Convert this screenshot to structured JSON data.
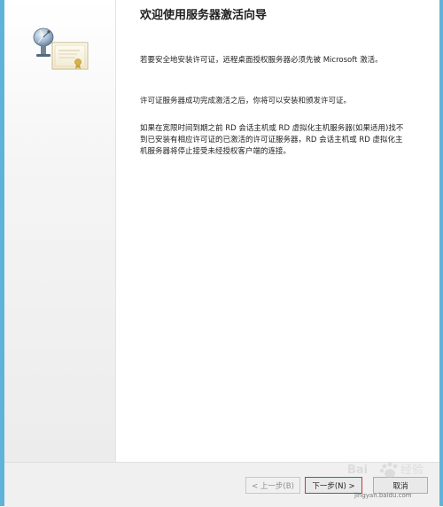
{
  "wizard": {
    "title": "欢迎使用服务器激活向导",
    "paragraph1": "若要安全地安装许可证，远程桌面授权服务器必须先被 Microsoft 激活。",
    "paragraph2": "许可证服务器成功完成激活之后，你将可以安装和颁发许可证。",
    "paragraph3": "如果在宽限时间到期之前 RD 会话主机或 RD 虚拟化主机服务器(如果适用)找不到已安装有相应许可证的已激活的许可证服务器，RD 会话主机或 RD 虚拟化主机服务器将停止接受未经授权客户端的连接。",
    "icon": "license-server-certificate-icon"
  },
  "footer": {
    "back_label": "< 上一步(B)",
    "next_label": "下一步(N) >",
    "cancel_label": "取消"
  },
  "watermark": {
    "text": "jingyan.baidu.com"
  },
  "colors": {
    "frame": "#5fb3d9",
    "next_button_border": "#c43a3a"
  }
}
